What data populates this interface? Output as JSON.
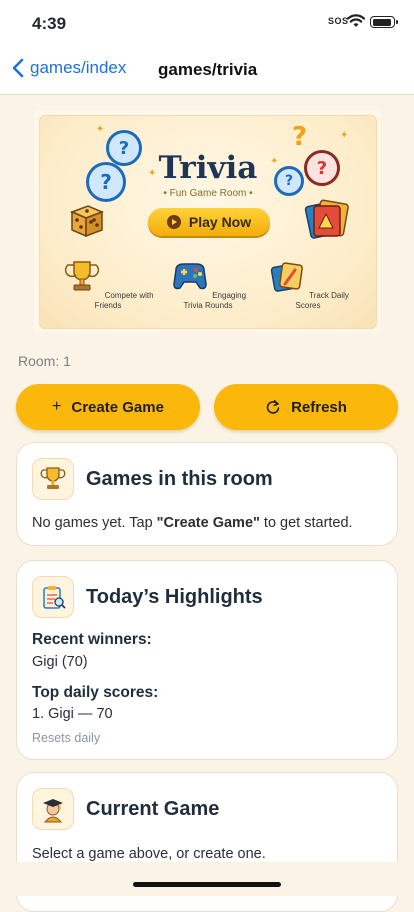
{
  "status_bar": {
    "time": "4:39",
    "sos": "SOS"
  },
  "nav": {
    "back_label": "games/index",
    "title": "games/trivia"
  },
  "hero": {
    "title": "Trivia",
    "subtitle": "• Fun Game Room •",
    "play_label": "Play Now",
    "features": [
      {
        "label": "Compete with Friends",
        "icon": "trophy-icon"
      },
      {
        "label": "Engaging Trivia Rounds",
        "icon": "gamepad-icon"
      },
      {
        "label": "Track Daily Scores",
        "icon": "cards-icon"
      }
    ]
  },
  "room_label": "Room: 1",
  "actions": {
    "create_label": "Create Game",
    "create_icon": "+",
    "refresh_label": "Refresh"
  },
  "games_card": {
    "title": "Games in this room",
    "empty_prefix": "No games yet. Tap ",
    "empty_action": "\"Create Game\"",
    "empty_suffix": " to get started."
  },
  "highlights_card": {
    "title": "Today’s Highlights",
    "recent_winners_label": "Recent winners:",
    "recent_winners_value": "Gigi (70)",
    "top_scores_label": "Top daily scores:",
    "top_scores_value": "1. Gigi — 70",
    "reset_note": "Resets daily"
  },
  "current_game_card": {
    "title": "Current Game",
    "body": "Select a game above, or create one."
  },
  "colors": {
    "accent": "#fbb80b",
    "link": "#1f6fe0",
    "background": "#fbf4e6",
    "card_title": "#1f2d3d"
  }
}
